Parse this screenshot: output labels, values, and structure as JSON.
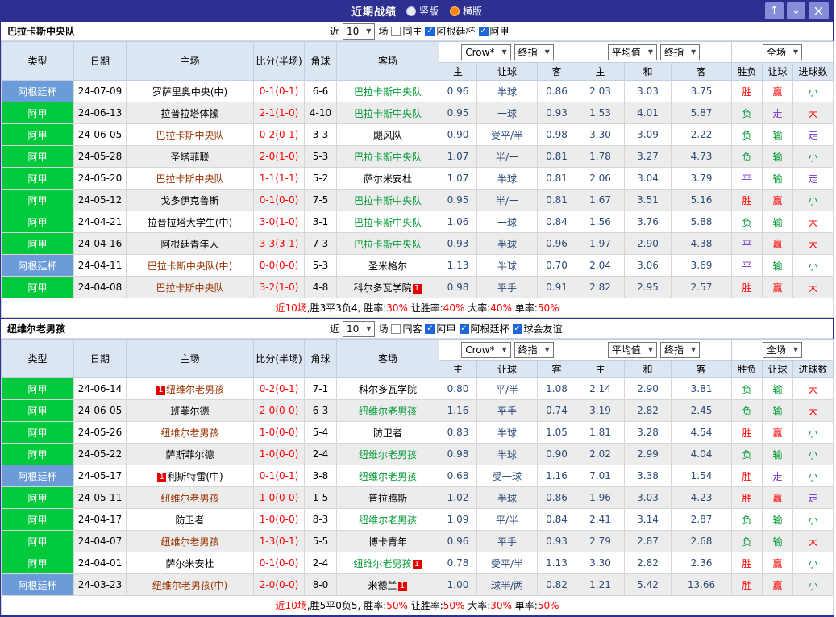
{
  "title_bar": {
    "title": "近期战绩",
    "radio_options": [
      {
        "label": "竖版",
        "selected": false
      },
      {
        "label": "横版",
        "selected": true
      }
    ],
    "buttons": {
      "up": "↑",
      "down": "↓",
      "close": "×"
    }
  },
  "columns": [
    "类型",
    "日期",
    "主场",
    "比分(半场)",
    "角球",
    "客场",
    "主",
    "让球",
    "客",
    "主",
    "和",
    "客",
    "胜负",
    "让球",
    "进球数"
  ],
  "header_dropdowns": {
    "odds_group": [
      "Crow*",
      "终指"
    ],
    "avg_group": [
      "平均值",
      "终指"
    ],
    "scope_group": [
      "全场"
    ]
  },
  "colors": {
    "accent_bar": "#2d3091",
    "type": {
      "阿根廷杯": "#6b9cd9",
      "阿甲": "#00c93c"
    },
    "badge": "#e60000",
    "text": {
      "red": "#ff0000",
      "green": "#009933",
      "purple": "#7133cc",
      "maroon": "#993300",
      "black": "#000000",
      "navy": "#2b4a77"
    }
  },
  "sections": [
    {
      "team": "巴拉卡斯中央队",
      "filter": {
        "recent_label": "近",
        "count": "10",
        "games_label": "场",
        "checkboxes": [
          {
            "label": "同主",
            "checked": false
          },
          {
            "label": "阿根廷杯",
            "checked": true
          },
          {
            "label": "阿甲",
            "checked": true
          }
        ]
      },
      "rows": [
        {
          "type": "阿根廷杯",
          "date": "24-07-09",
          "home": {
            "name": "罗萨里奥中央(中)",
            "color": "black"
          },
          "score": "0-1(0-1)",
          "corner": "6-6",
          "away": {
            "name": "巴拉卡斯中央队",
            "color": "green"
          },
          "odds": [
            "0.96",
            "半球",
            "0.86"
          ],
          "avg": [
            "2.03",
            "3.03",
            "3.75"
          ],
          "results": [
            [
              "胜",
              "red"
            ],
            [
              "赢",
              "red"
            ],
            [
              "小",
              "green"
            ]
          ]
        },
        {
          "type": "阿甲",
          "date": "24-06-13",
          "home": {
            "name": "拉普拉塔体操",
            "color": "black"
          },
          "score": "2-1(1-0)",
          "corner": "4-10",
          "away": {
            "name": "巴拉卡斯中央队",
            "color": "green"
          },
          "odds": [
            "0.95",
            "一球",
            "0.93"
          ],
          "avg": [
            "1.53",
            "4.01",
            "5.87"
          ],
          "results": [
            [
              "负",
              "green"
            ],
            [
              "走",
              "purple"
            ],
            [
              "大",
              "red"
            ]
          ]
        },
        {
          "type": "阿甲",
          "date": "24-06-05",
          "home": {
            "name": "巴拉卡斯中央队",
            "color": "maroon"
          },
          "score": "0-2(0-1)",
          "corner": "3-3",
          "away": {
            "name": "飓风队",
            "color": "black"
          },
          "odds": [
            "0.90",
            "受平/半",
            "0.98"
          ],
          "avg": [
            "3.30",
            "3.09",
            "2.22"
          ],
          "results": [
            [
              "负",
              "green"
            ],
            [
              "输",
              "green"
            ],
            [
              "走",
              "purple"
            ]
          ]
        },
        {
          "type": "阿甲",
          "date": "24-05-28",
          "home": {
            "name": "圣塔菲联",
            "color": "black"
          },
          "score": "2-0(1-0)",
          "corner": "5-3",
          "away": {
            "name": "巴拉卡斯中央队",
            "color": "green"
          },
          "odds": [
            "1.07",
            "半/一",
            "0.81"
          ],
          "avg": [
            "1.78",
            "3.27",
            "4.73"
          ],
          "results": [
            [
              "负",
              "green"
            ],
            [
              "输",
              "green"
            ],
            [
              "小",
              "green"
            ]
          ]
        },
        {
          "type": "阿甲",
          "date": "24-05-20",
          "home": {
            "name": "巴拉卡斯中央队",
            "color": "maroon"
          },
          "score": "1-1(1-1)",
          "corner": "5-2",
          "away": {
            "name": "萨尔米安杜",
            "color": "black"
          },
          "odds": [
            "1.07",
            "半球",
            "0.81"
          ],
          "avg": [
            "2.06",
            "3.04",
            "3.79"
          ],
          "results": [
            [
              "平",
              "purple"
            ],
            [
              "输",
              "green"
            ],
            [
              "走",
              "purple"
            ]
          ]
        },
        {
          "type": "阿甲",
          "date": "24-05-12",
          "home": {
            "name": "戈多伊克鲁斯",
            "color": "black"
          },
          "score": "0-1(0-0)",
          "corner": "7-5",
          "away": {
            "name": "巴拉卡斯中央队",
            "color": "green"
          },
          "odds": [
            "0.95",
            "半/一",
            "0.81"
          ],
          "avg": [
            "1.67",
            "3.51",
            "5.16"
          ],
          "results": [
            [
              "胜",
              "red"
            ],
            [
              "赢",
              "red"
            ],
            [
              "小",
              "green"
            ]
          ]
        },
        {
          "type": "阿甲",
          "date": "24-04-21",
          "home": {
            "name": "拉普拉塔大学生(中)",
            "color": "black"
          },
          "score": "3-0(1-0)",
          "corner": "3-1",
          "away": {
            "name": "巴拉卡斯中央队",
            "color": "green"
          },
          "odds": [
            "1.06",
            "一球",
            "0.84"
          ],
          "avg": [
            "1.56",
            "3.76",
            "5.88"
          ],
          "results": [
            [
              "负",
              "green"
            ],
            [
              "输",
              "green"
            ],
            [
              "大",
              "red"
            ]
          ]
        },
        {
          "type": "阿甲",
          "date": "24-04-16",
          "home": {
            "name": "阿根廷青年人",
            "color": "black"
          },
          "score": "3-3(3-1)",
          "corner": "7-3",
          "away": {
            "name": "巴拉卡斯中央队",
            "color": "green"
          },
          "odds": [
            "0.93",
            "半球",
            "0.96"
          ],
          "avg": [
            "1.97",
            "2.90",
            "4.38"
          ],
          "results": [
            [
              "平",
              "purple"
            ],
            [
              "赢",
              "red"
            ],
            [
              "大",
              "red"
            ]
          ]
        },
        {
          "type": "阿根廷杯",
          "date": "24-04-11",
          "home": {
            "name": "巴拉卡斯中央队(中)",
            "color": "maroon"
          },
          "score": "0-0(0-0)",
          "corner": "5-3",
          "away": {
            "name": "圣米格尔",
            "color": "black"
          },
          "odds": [
            "1.13",
            "半球",
            "0.70"
          ],
          "avg": [
            "2.04",
            "3.06",
            "3.69"
          ],
          "results": [
            [
              "平",
              "purple"
            ],
            [
              "输",
              "green"
            ],
            [
              "小",
              "green"
            ]
          ]
        },
        {
          "type": "阿甲",
          "date": "24-04-08",
          "home": {
            "name": "巴拉卡斯中央队",
            "color": "maroon"
          },
          "score": "3-2(1-0)",
          "corner": "4-8",
          "away": {
            "name": "科尔多瓦学院",
            "color": "black",
            "badge": "1",
            "badge_pos": "after"
          },
          "odds": [
            "0.98",
            "平手",
            "0.91"
          ],
          "avg": [
            "2.82",
            "2.95",
            "2.57"
          ],
          "results": [
            [
              "胜",
              "red"
            ],
            [
              "赢",
              "red"
            ],
            [
              "大",
              "red"
            ]
          ]
        }
      ],
      "summary": [
        [
          "近10场",
          "red"
        ],
        [
          ",胜3平3负4, ",
          "black"
        ],
        [
          "胜率:",
          "black"
        ],
        [
          "30%",
          "red"
        ],
        [
          " 让胜率:",
          "black"
        ],
        [
          "40%",
          "red"
        ],
        [
          " 大率:",
          "black"
        ],
        [
          "40%",
          "red"
        ],
        [
          " 单率:",
          "black"
        ],
        [
          "50%",
          "red"
        ]
      ]
    },
    {
      "team": "纽维尔老男孩",
      "filter": {
        "recent_label": "近",
        "count": "10",
        "games_label": "场",
        "checkboxes": [
          {
            "label": "同客",
            "checked": false
          },
          {
            "label": "阿甲",
            "checked": true
          },
          {
            "label": "阿根廷杯",
            "checked": true
          },
          {
            "label": "球会友谊",
            "checked": true
          }
        ]
      },
      "rows": [
        {
          "type": "阿甲",
          "date": "24-06-14",
          "home": {
            "name": "纽维尔老男孩",
            "color": "maroon",
            "badge": "1",
            "badge_pos": "before"
          },
          "score": "0-2(0-1)",
          "corner": "7-1",
          "away": {
            "name": "科尔多瓦学院",
            "color": "black"
          },
          "odds": [
            "0.80",
            "平/半",
            "1.08"
          ],
          "avg": [
            "2.14",
            "2.90",
            "3.81"
          ],
          "results": [
            [
              "负",
              "green"
            ],
            [
              "输",
              "green"
            ],
            [
              "大",
              "red"
            ]
          ]
        },
        {
          "type": "阿甲",
          "date": "24-06-05",
          "home": {
            "name": "班菲尔德",
            "color": "black"
          },
          "score": "2-0(0-0)",
          "corner": "6-3",
          "away": {
            "name": "纽维尔老男孩",
            "color": "green"
          },
          "odds": [
            "1.16",
            "平手",
            "0.74"
          ],
          "avg": [
            "3.19",
            "2.82",
            "2.45"
          ],
          "results": [
            [
              "负",
              "green"
            ],
            [
              "输",
              "green"
            ],
            [
              "大",
              "red"
            ]
          ]
        },
        {
          "type": "阿甲",
          "date": "24-05-26",
          "home": {
            "name": "纽维尔老男孩",
            "color": "maroon"
          },
          "score": "1-0(0-0)",
          "corner": "5-4",
          "away": {
            "name": "防卫者",
            "color": "black"
          },
          "odds": [
            "0.83",
            "半球",
            "1.05"
          ],
          "avg": [
            "1.81",
            "3.28",
            "4.54"
          ],
          "results": [
            [
              "胜",
              "red"
            ],
            [
              "赢",
              "red"
            ],
            [
              "小",
              "green"
            ]
          ]
        },
        {
          "type": "阿甲",
          "date": "24-05-22",
          "home": {
            "name": "萨斯菲尔德",
            "color": "black"
          },
          "score": "1-0(0-0)",
          "corner": "2-4",
          "away": {
            "name": "纽维尔老男孩",
            "color": "green"
          },
          "odds": [
            "0.98",
            "半球",
            "0.90"
          ],
          "avg": [
            "2.02",
            "2.99",
            "4.04"
          ],
          "results": [
            [
              "负",
              "green"
            ],
            [
              "输",
              "green"
            ],
            [
              "小",
              "green"
            ]
          ]
        },
        {
          "type": "阿根廷杯",
          "date": "24-05-17",
          "home": {
            "name": "利斯特雷(中)",
            "color": "black",
            "badge": "1",
            "badge_pos": "before"
          },
          "score": "0-1(0-1)",
          "corner": "3-8",
          "away": {
            "name": "纽维尔老男孩",
            "color": "green"
          },
          "odds": [
            "0.68",
            "受一球",
            "1.16"
          ],
          "avg": [
            "7.01",
            "3.38",
            "1.54"
          ],
          "results": [
            [
              "胜",
              "red"
            ],
            [
              "走",
              "purple"
            ],
            [
              "小",
              "green"
            ]
          ]
        },
        {
          "type": "阿甲",
          "date": "24-05-11",
          "home": {
            "name": "纽维尔老男孩",
            "color": "maroon"
          },
          "score": "1-0(0-0)",
          "corner": "1-5",
          "away": {
            "name": "普拉腾斯",
            "color": "black"
          },
          "odds": [
            "1.02",
            "半球",
            "0.86"
          ],
          "avg": [
            "1.96",
            "3.03",
            "4.23"
          ],
          "results": [
            [
              "胜",
              "red"
            ],
            [
              "赢",
              "red"
            ],
            [
              "走",
              "purple"
            ]
          ]
        },
        {
          "type": "阿甲",
          "date": "24-04-17",
          "home": {
            "name": "防卫者",
            "color": "black"
          },
          "score": "1-0(0-0)",
          "corner": "8-3",
          "away": {
            "name": "纽维尔老男孩",
            "color": "green"
          },
          "odds": [
            "1.09",
            "平/半",
            "0.84"
          ],
          "avg": [
            "2.41",
            "3.14",
            "2.87"
          ],
          "results": [
            [
              "负",
              "green"
            ],
            [
              "输",
              "green"
            ],
            [
              "小",
              "green"
            ]
          ]
        },
        {
          "type": "阿甲",
          "date": "24-04-07",
          "home": {
            "name": "纽维尔老男孩",
            "color": "maroon"
          },
          "score": "1-3(0-1)",
          "corner": "5-5",
          "away": {
            "name": "博卡青年",
            "color": "black"
          },
          "odds": [
            "0.96",
            "平手",
            "0.93"
          ],
          "avg": [
            "2.79",
            "2.87",
            "2.68"
          ],
          "results": [
            [
              "负",
              "green"
            ],
            [
              "输",
              "green"
            ],
            [
              "大",
              "red"
            ]
          ]
        },
        {
          "type": "阿甲",
          "date": "24-04-01",
          "home": {
            "name": "萨尔米安杜",
            "color": "black"
          },
          "score": "0-1(0-0)",
          "corner": "2-4",
          "away": {
            "name": "纽维尔老男孩",
            "color": "green",
            "badge": "1",
            "badge_pos": "after"
          },
          "odds": [
            "0.78",
            "受平/半",
            "1.13"
          ],
          "avg": [
            "3.30",
            "2.82",
            "2.36"
          ],
          "results": [
            [
              "胜",
              "red"
            ],
            [
              "赢",
              "red"
            ],
            [
              "小",
              "green"
            ]
          ]
        },
        {
          "type": "阿根廷杯",
          "date": "24-03-23",
          "home": {
            "name": "纽维尔老男孩(中)",
            "color": "maroon"
          },
          "score": "2-0(0-0)",
          "corner": "8-0",
          "away": {
            "name": "米德兰",
            "color": "black",
            "badge": "1",
            "badge_pos": "after"
          },
          "odds": [
            "1.00",
            "球半/两",
            "0.82"
          ],
          "avg": [
            "1.21",
            "5.42",
            "13.66"
          ],
          "results": [
            [
              "胜",
              "red"
            ],
            [
              "赢",
              "red"
            ],
            [
              "小",
              "green"
            ]
          ]
        }
      ],
      "summary": [
        [
          "近10场",
          "red"
        ],
        [
          ",胜5平0负5, ",
          "black"
        ],
        [
          "胜率:",
          "black"
        ],
        [
          "50%",
          "red"
        ],
        [
          " 让胜率:",
          "black"
        ],
        [
          "50%",
          "red"
        ],
        [
          " 大率:",
          "black"
        ],
        [
          "30%",
          "red"
        ],
        [
          " 单率:",
          "black"
        ],
        [
          "50%",
          "red"
        ]
      ]
    }
  ]
}
